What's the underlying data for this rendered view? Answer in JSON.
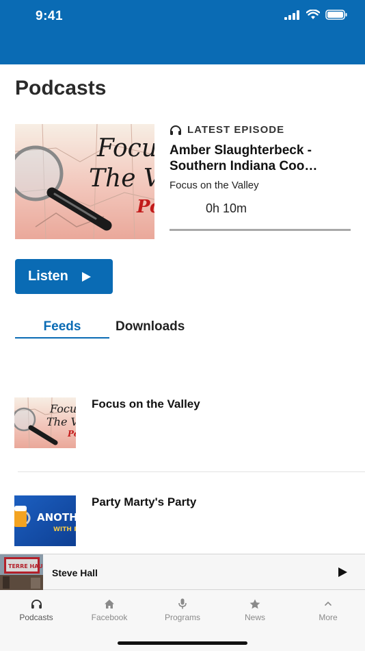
{
  "status_bar": {
    "time": "9:41",
    "background": "#0a6bb4"
  },
  "page": {
    "title": "Podcasts"
  },
  "latest": {
    "label": "LATEST EPISODE",
    "icon": "headphones-icon",
    "title_line1": "Amber Slaughterbeck -",
    "title_line2": "Southern Indiana Coo…",
    "show": "Focus on the Valley",
    "duration": "0h 10m",
    "progress": 0,
    "art_text_1": "Focu",
    "art_text_2": "The V",
    "art_text_3": "Po"
  },
  "listen_button": {
    "label": "Listen",
    "icon": "play-icon",
    "color": "#0a6bb4"
  },
  "tabs": [
    {
      "label": "Feeds",
      "active": true
    },
    {
      "label": "Downloads",
      "active": false
    }
  ],
  "feeds": [
    {
      "title": "Focus on the Valley",
      "art_text_1": "Focu",
      "art_text_2": "The V",
      "art_text_3": "Po"
    },
    {
      "title": "Party Marty's Party",
      "art_text_1": "ANOTHE",
      "art_text_2": "WITH P"
    }
  ],
  "mini_player": {
    "title": "Steve Hall",
    "art_text": "TERRE HAU",
    "icon": "play-icon"
  },
  "tab_bar": [
    {
      "label": "Podcasts",
      "icon": "headphones-icon",
      "active": true
    },
    {
      "label": "Facebook",
      "icon": "home-icon",
      "active": false
    },
    {
      "label": "Programs",
      "icon": "microphone-icon",
      "active": false
    },
    {
      "label": "News",
      "icon": "star-icon",
      "active": false
    },
    {
      "label": "More",
      "icon": "chevron-up-icon",
      "active": false
    }
  ]
}
